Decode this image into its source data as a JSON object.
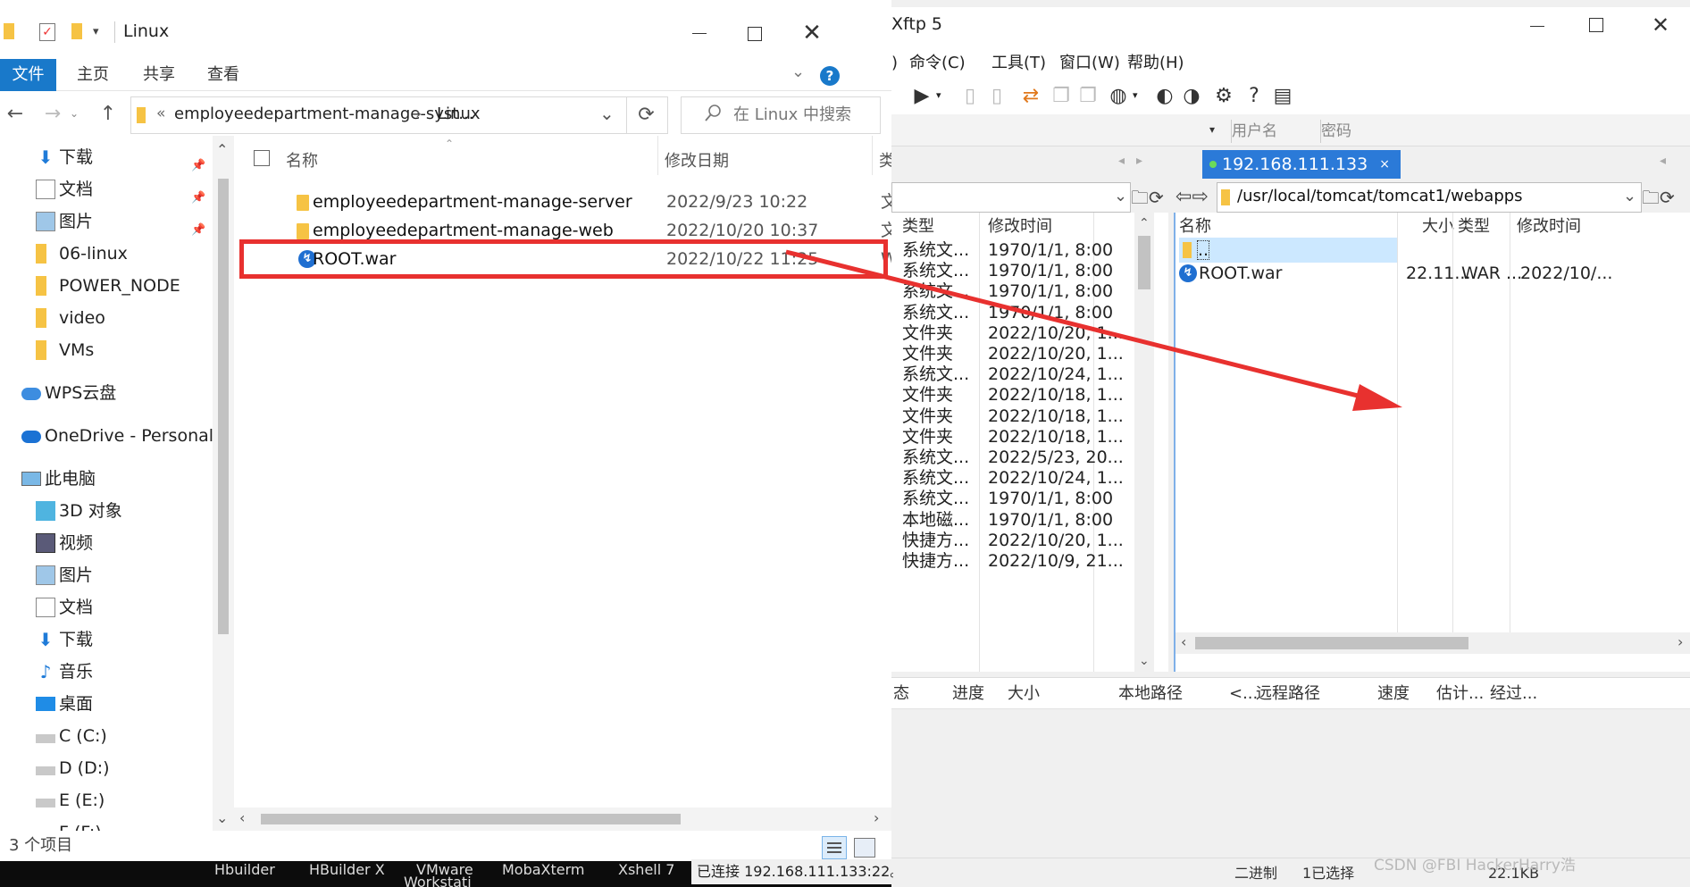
{
  "explorer": {
    "title": "Linux",
    "ribbon_tabs": [
      "文件",
      "主页",
      "共享",
      "查看"
    ],
    "breadcrumb": [
      "«",
      "employeedepartment-manage-syst...",
      "›",
      "Linux"
    ],
    "search_placeholder": "在 Linux 中搜索",
    "nav_items": [
      {
        "label": "下载",
        "icon": "download-icon",
        "pinned": true
      },
      {
        "label": "文档",
        "icon": "document-icon",
        "pinned": true
      },
      {
        "label": "图片",
        "icon": "picture-icon",
        "pinned": true
      },
      {
        "label": "06-linux",
        "icon": "folder-icon",
        "pinned": false
      },
      {
        "label": "POWER_NODE",
        "icon": "folder-icon",
        "pinned": false
      },
      {
        "label": "video",
        "icon": "folder-icon",
        "pinned": false
      },
      {
        "label": "VMs",
        "icon": "folder-icon",
        "pinned": false
      },
      {
        "label": "WPS云盘",
        "icon": "cloud-icon",
        "pinned": false
      },
      {
        "label": "OneDrive - Personal",
        "icon": "onedrive-icon",
        "pinned": false
      },
      {
        "label": "此电脑",
        "icon": "computer-icon",
        "pinned": false
      },
      {
        "label": "3D 对象",
        "icon": "cube-icon",
        "pinned": false
      },
      {
        "label": "视频",
        "icon": "video-icon",
        "pinned": false
      },
      {
        "label": "图片",
        "icon": "picture-icon",
        "pinned": false
      },
      {
        "label": "文档",
        "icon": "document-icon",
        "pinned": false
      },
      {
        "label": "下载",
        "icon": "download-icon",
        "pinned": false
      },
      {
        "label": "音乐",
        "icon": "music-icon",
        "pinned": false
      },
      {
        "label": "桌面",
        "icon": "desktop-icon",
        "pinned": false
      },
      {
        "label": "C (C:)",
        "icon": "drive-icon",
        "pinned": false
      },
      {
        "label": "D (D:)",
        "icon": "drive-icon",
        "pinned": false
      },
      {
        "label": "E (E:)",
        "icon": "drive-icon",
        "pinned": false
      },
      {
        "label": "F (F:)",
        "icon": "drive-icon",
        "pinned": false
      }
    ],
    "columns": {
      "name": "名称",
      "date": "修改日期",
      "type": "类"
    },
    "files": [
      {
        "name": "employeedepartment-manage-server",
        "date": "2022/9/23 10:22",
        "type": "文",
        "icon": "folder-icon"
      },
      {
        "name": "employeedepartment-manage-web",
        "date": "2022/10/20 10:37",
        "type": "文",
        "icon": "folder-icon"
      },
      {
        "name": "ROOT.war",
        "date": "2022/10/22 11:25",
        "type": "W",
        "icon": "xftp-file-icon"
      }
    ],
    "status": "3 个项目"
  },
  "xftp": {
    "title": "Xftp 5",
    "menu": [
      ")",
      "命令(C)",
      "工具(T)",
      "窗口(W)",
      "帮助(H)"
    ],
    "conn_fields": {
      "user": "用户名",
      "password": "密码"
    },
    "remote_tab": "192.168.111.133",
    "remote_tab_close": "×",
    "remote_path": "/usr/local/tomcat/tomcat1/webapps",
    "local_columns": {
      "type": "类型",
      "mtime": "修改时间"
    },
    "local_rows": [
      {
        "type": "系统文...",
        "mtime": "1970/1/1, 8:00"
      },
      {
        "type": "系统文...",
        "mtime": "1970/1/1, 8:00"
      },
      {
        "type": "系统文...",
        "mtime": "1970/1/1, 8:00"
      },
      {
        "type": "系统文...",
        "mtime": "1970/1/1, 8:00"
      },
      {
        "type": "文件夹",
        "mtime": "2022/10/20, 1..."
      },
      {
        "type": "文件夹",
        "mtime": "2022/10/20, 1..."
      },
      {
        "type": "系统文...",
        "mtime": "2022/10/24, 1..."
      },
      {
        "type": "文件夹",
        "mtime": "2022/10/18, 1..."
      },
      {
        "type": "文件夹",
        "mtime": "2022/10/18, 1..."
      },
      {
        "type": "文件夹",
        "mtime": "2022/10/18, 1..."
      },
      {
        "type": "系统文...",
        "mtime": "2022/5/23, 20..."
      },
      {
        "type": "系统文...",
        "mtime": "2022/10/24, 1..."
      },
      {
        "type": "系统文...",
        "mtime": "1970/1/1, 8:00"
      },
      {
        "type": "本地磁...",
        "mtime": "1970/1/1, 8:00"
      },
      {
        "type": "快捷方...",
        "mtime": "2022/10/20, 1..."
      },
      {
        "type": "快捷方...",
        "mtime": "2022/10/9, 21..."
      }
    ],
    "remote_columns": {
      "name": "名称",
      "size": "大小",
      "type": "类型",
      "mtime": "修改时间"
    },
    "remote_rows": [
      {
        "name": "..",
        "size": "",
        "type": "",
        "mtime": ""
      },
      {
        "name": "ROOT.war",
        "size": "22.11...",
        "type": "WAR ...",
        "mtime": "2022/10/..."
      }
    ],
    "queue_columns": [
      "态",
      "进度",
      "大小",
      "本地路径",
      "<...",
      "远程路径",
      "速度",
      "估计...",
      "经过..."
    ],
    "status_left": "已连接 192.168.111.133:22。",
    "status_mode": "二进制",
    "status_selected": "1已选择",
    "status_size": "22.1KB",
    "watermark": "CSDN @FBI HackerHarry浩"
  },
  "taskbar": [
    "Hbuilder",
    "HBuilder X",
    "VMware",
    "MobaXterm",
    "Xshell 7",
    "Workstati"
  ],
  "colors": {
    "accent": "#1979ca",
    "xftp_tab": "#2b7ad8",
    "annotation": "#e8312f",
    "selection": "#cce8ff"
  }
}
